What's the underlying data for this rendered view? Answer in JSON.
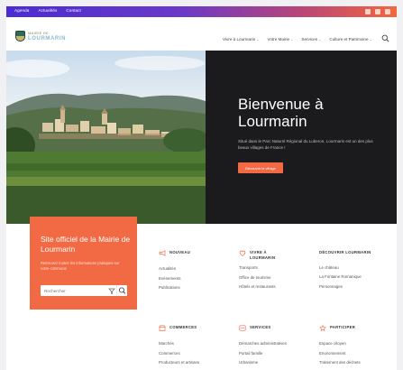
{
  "topbar": {
    "links": [
      "Agenda",
      "Actualités",
      "Contact"
    ],
    "icons": [
      "facebook-icon",
      "instagram-icon",
      "youtube-icon"
    ]
  },
  "header": {
    "logo_line1": "MAIRIE DE",
    "logo_line2": "LOURMARIN",
    "nav": [
      {
        "label": "Vivre à Lourmarin"
      },
      {
        "label": "Votre Mairie"
      },
      {
        "label": "Services"
      },
      {
        "label": "Culture et Patrimoine"
      }
    ]
  },
  "hero": {
    "title": "Bienvenue à Lourmarin",
    "text": "Situé dans le Parc Naturel Régional du Luberon, Lourmarin est un des plus beaux villages de France !",
    "button": "Découvrir le village"
  },
  "card": {
    "title": "Site officiel de la Mairie de Lourmarin",
    "text": "Retrouvez toutes les informations pratiques sur votre commune",
    "search_placeholder": "Rechercher"
  },
  "categories": [
    {
      "title": "NOUVEAU",
      "icon": "megaphone-icon",
      "links": [
        "Actualités",
        "Evènements",
        "Publications"
      ]
    },
    {
      "title": "VIVRE À LOURMARIN",
      "icon": "heart-pin-icon",
      "links": [
        "Transports",
        "Office de tourisme",
        "Hôtels et restaurants"
      ]
    },
    {
      "title": "DÉCOUVRIR LOURMARIN",
      "icon": "compass-icon",
      "links": [
        "Le château",
        "La Fontaine Romanique",
        "Personnages"
      ]
    },
    {
      "title": "COMMERCES",
      "icon": "shop-icon",
      "links": [
        "Marchés",
        "Commerces",
        "Producteurs et artisans"
      ]
    },
    {
      "title": "SERVICES",
      "icon": "services-icon",
      "links": [
        "Démarches administratives",
        "Portail famille",
        "Urbanisme"
      ]
    },
    {
      "title": "PARTICIPER",
      "icon": "participate-icon",
      "links": [
        "Espace citoyen",
        "Environnement",
        "Traitement des déchets"
      ]
    }
  ],
  "colors": {
    "accent": "#f26a43",
    "hero_dark": "#1b1b1d",
    "gradient_start": "#4b2bd0",
    "gradient_end": "#f2673d"
  }
}
